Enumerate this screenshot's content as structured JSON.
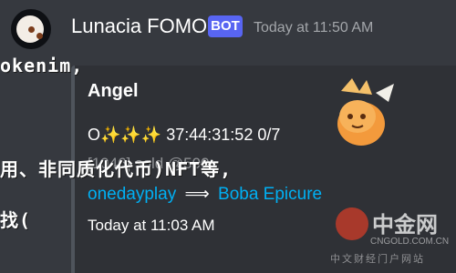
{
  "message": {
    "author": "Lunacia FOMO",
    "badge": "BOT",
    "timestamp": "Today at 11:50 AM"
  },
  "overlay_text": {
    "line1": "okenim,",
    "line2": "用、非同质化代币)NFT等,",
    "line3": "找("
  },
  "embed": {
    "title": "Angel",
    "description": "O✨✨✨ 37:44:31:52 0/7",
    "sold_text": "[1046] sold @500",
    "trade": {
      "from": "onedayplay",
      "arrow": "⟹",
      "to": "Boba Epicure"
    },
    "footer_time": "Today at 11:03 AM",
    "thumbnail_icon": "angel-axie-creature"
  },
  "watermark": {
    "name_cn": "中金网",
    "domain": "CNGOLD.COM.CN",
    "tagline": "中文财经门户网站"
  },
  "colors": {
    "background": "#36393f",
    "embed_bg": "#2f3136",
    "bot_badge": "#5865f2",
    "link": "#00b0f4"
  }
}
